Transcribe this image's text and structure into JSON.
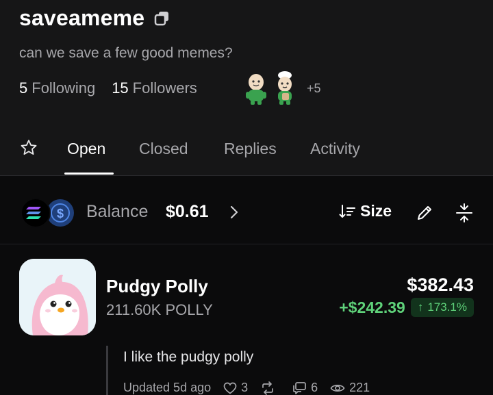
{
  "profile": {
    "name": "saveameme",
    "bio": "can we save a few good memes?",
    "following_count": "5",
    "following_label": "Following",
    "followers_count": "15",
    "followers_label": "Followers",
    "more_followers": "+5"
  },
  "tabs": [
    {
      "label": "Open",
      "active": true
    },
    {
      "label": "Closed",
      "active": false
    },
    {
      "label": "Replies",
      "active": false
    },
    {
      "label": "Activity",
      "active": false
    }
  ],
  "balance": {
    "label": "Balance",
    "value": "$0.61"
  },
  "toolbar": {
    "sort_label": "Size"
  },
  "position": {
    "name": "Pudgy Polly",
    "amount": "211.60K POLLY",
    "value": "$382.43",
    "pnl": "+$242.39",
    "pnl_percent": "173.1%",
    "note": "I like the pudgy polly",
    "updated": "Updated 5d ago",
    "likes": "3",
    "replies": "6",
    "views": "221"
  },
  "colors": {
    "background": "#0b0b0c",
    "header_background": "#161617",
    "muted_text": "#a7a7ab",
    "positive": "#5fd27a",
    "positive_badge_bg": "#12331c"
  },
  "icons": [
    "copy-icon",
    "star-icon",
    "solana-icon",
    "usdc-icon",
    "chevron-right-icon",
    "sort-icon",
    "pencil-icon",
    "collapse-icon",
    "heart-icon",
    "repost-icon",
    "comment-icon",
    "eye-icon",
    "arrow-up-icon"
  ]
}
